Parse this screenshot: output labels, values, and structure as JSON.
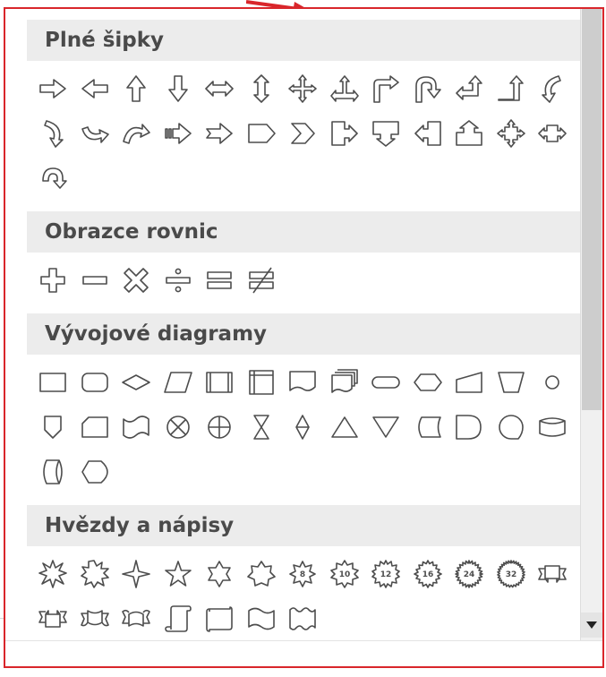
{
  "sections": [
    {
      "title": "Plné šipky",
      "shapes": [
        "arrow-right",
        "arrow-left",
        "arrow-up",
        "arrow-down",
        "arrow-left-right",
        "arrow-up-down",
        "arrow-quad",
        "arrow-left-right-up",
        "arrow-bent",
        "arrow-u-turn",
        "arrow-left-up",
        "arrow-bent-up",
        "arrow-curved-right",
        "arrow-curved-left",
        "arrow-curved-up",
        "arrow-curved-down",
        "arrow-striped-right",
        "arrow-notched-right",
        "pentagon",
        "chevron",
        "callout-right-arrow",
        "callout-down-arrow",
        "callout-left-arrow",
        "callout-up-arrow",
        "callout-quad-arrow",
        "callout-left-right-arrow",
        "circular-arrow"
      ]
    },
    {
      "title": "Obrazce rovnic",
      "shapes": [
        "plus",
        "minus",
        "multiply",
        "division",
        "equal",
        "not-equal"
      ]
    },
    {
      "title": "Vývojové diagramy",
      "shapes": [
        "flow-process",
        "flow-alternate-process",
        "flow-decision",
        "flow-data",
        "flow-predefined",
        "flow-internal-storage",
        "flow-document",
        "flow-multidocument",
        "flow-terminator",
        "flow-preparation",
        "flow-manual-input",
        "flow-manual-operation",
        "flow-connector",
        "flow-offpage",
        "flow-card",
        "flow-punched-tape",
        "flow-summing",
        "flow-or",
        "flow-collate",
        "flow-sort",
        "flow-extract",
        "flow-merge",
        "flow-stored-data",
        "flow-delay",
        "flow-sequential-storage",
        "flow-magnetic-disk",
        "flow-direct-storage",
        "flow-display"
      ]
    },
    {
      "title": "Hvězdy a nápisy",
      "shapes": [
        "explosion-1",
        "explosion-2",
        "star-4",
        "star-5",
        "star-6",
        "star-7",
        "star-8",
        "star-10",
        "star-12",
        "star-16",
        "star-24",
        "star-32",
        "ribbon-down",
        "ribbon-up",
        "ribbon-curved-down",
        "ribbon-curved-up",
        "scroll-vertical",
        "scroll-horizontal",
        "wave",
        "double-wave"
      ]
    }
  ],
  "star_labels": {
    "star-8": "8",
    "star-10": "10",
    "star-12": "12",
    "star-16": "16",
    "star-24": "24",
    "star-32": "32"
  },
  "colors": {
    "highlight_border": "#d9262b",
    "header_bg": "#ececec",
    "icon_stroke": "#4d4d4d"
  }
}
